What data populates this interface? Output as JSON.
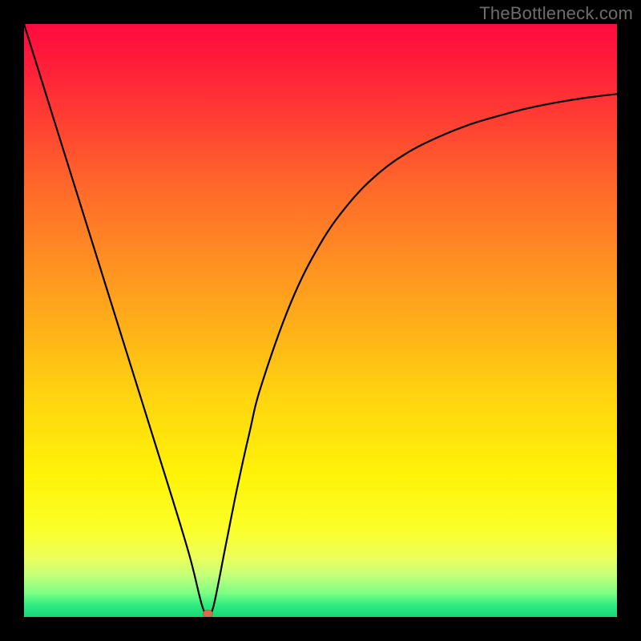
{
  "watermark": "TheBottleneck.com",
  "colors": {
    "frame": "#000000",
    "dot": "#d76b50",
    "curve": "#000000"
  },
  "chart_data": {
    "type": "line",
    "title": "",
    "xlabel": "",
    "ylabel": "",
    "xlim": [
      0,
      100
    ],
    "ylim": [
      0,
      100
    ],
    "grid": false,
    "legend": false,
    "series": [
      {
        "name": "bottleneck-curve",
        "x": [
          0,
          5,
          10,
          15,
          20,
          25,
          28,
          30,
          31,
          32,
          34,
          36,
          38,
          40,
          45,
          50,
          55,
          60,
          65,
          70,
          75,
          80,
          85,
          90,
          95,
          100
        ],
        "values": [
          100,
          84,
          68,
          52,
          36,
          20,
          10,
          2,
          0,
          2,
          12,
          22,
          31,
          39,
          53,
          63,
          70,
          75,
          78.5,
          81,
          83,
          84.5,
          85.8,
          86.8,
          87.6,
          88.2
        ]
      }
    ],
    "annotations": [
      {
        "name": "minimum-marker",
        "x": 31,
        "y": 0
      }
    ],
    "gradient_stops": [
      {
        "pos": 0.0,
        "color": "#ff0a3f"
      },
      {
        "pos": 0.16,
        "color": "#ff3e33"
      },
      {
        "pos": 0.4,
        "color": "#ff8f22"
      },
      {
        "pos": 0.64,
        "color": "#ffd70f"
      },
      {
        "pos": 0.85,
        "color": "#fbff28"
      },
      {
        "pos": 0.96,
        "color": "#7bff84"
      },
      {
        "pos": 1.0,
        "color": "#17d67a"
      }
    ]
  }
}
